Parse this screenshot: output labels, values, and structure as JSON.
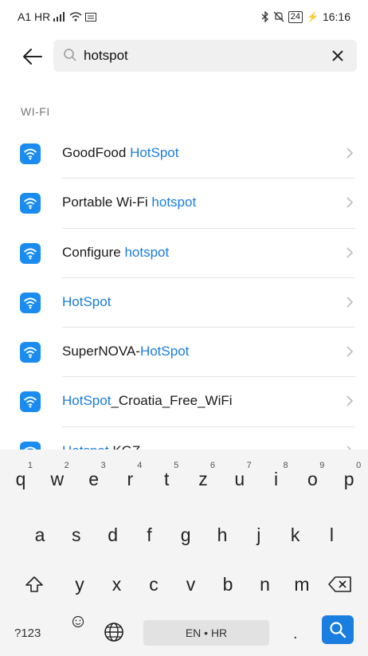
{
  "status_bar": {
    "carrier": "A1 HR",
    "battery": "24",
    "time": "16:16"
  },
  "search": {
    "value": "hotspot",
    "placeholder": ""
  },
  "section_title": "WI-FI",
  "results": [
    {
      "pre": "GoodFood ",
      "hl": "HotSpot",
      "post": ""
    },
    {
      "pre": "Portable Wi-Fi ",
      "hl": "hotspot",
      "post": ""
    },
    {
      "pre": "Configure ",
      "hl": "hotspot",
      "post": ""
    },
    {
      "pre": "",
      "hl": "HotSpot",
      "post": ""
    },
    {
      "pre": "SuperNOVA-",
      "hl": "HotSpot",
      "post": ""
    },
    {
      "pre": "",
      "hl": "HotSpot",
      "post": "_Croatia_Free_WiFi"
    },
    {
      "pre": "",
      "hl": "Hotspot",
      "post": " KGZ"
    }
  ],
  "keyboard": {
    "row1": [
      "q",
      "w",
      "e",
      "r",
      "t",
      "z",
      "u",
      "i",
      "o",
      "p"
    ],
    "row1_nums": [
      "1",
      "2",
      "3",
      "4",
      "5",
      "6",
      "7",
      "8",
      "9",
      "0"
    ],
    "row2": [
      "a",
      "s",
      "d",
      "f",
      "g",
      "h",
      "j",
      "k",
      "l"
    ],
    "row3": [
      "y",
      "x",
      "c",
      "v",
      "b",
      "n",
      "m"
    ],
    "symbols_key": "?123",
    "space_label": "EN • HR",
    "period": "."
  },
  "colors": {
    "accent": "#1a7de0",
    "wifi_icon_bg": "#1a8cf0"
  }
}
